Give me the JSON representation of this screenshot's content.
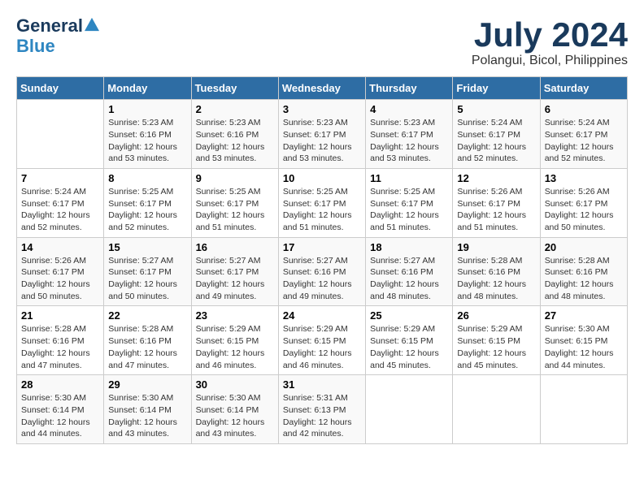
{
  "header": {
    "logo_line1": "General",
    "logo_line2": "Blue",
    "month_title": "July 2024",
    "subtitle": "Polangui, Bicol, Philippines"
  },
  "days_of_week": [
    "Sunday",
    "Monday",
    "Tuesday",
    "Wednesday",
    "Thursday",
    "Friday",
    "Saturday"
  ],
  "weeks": [
    [
      {
        "day": "",
        "info": ""
      },
      {
        "day": "1",
        "info": "Sunrise: 5:23 AM\nSunset: 6:16 PM\nDaylight: 12 hours\nand 53 minutes."
      },
      {
        "day": "2",
        "info": "Sunrise: 5:23 AM\nSunset: 6:16 PM\nDaylight: 12 hours\nand 53 minutes."
      },
      {
        "day": "3",
        "info": "Sunrise: 5:23 AM\nSunset: 6:17 PM\nDaylight: 12 hours\nand 53 minutes."
      },
      {
        "day": "4",
        "info": "Sunrise: 5:23 AM\nSunset: 6:17 PM\nDaylight: 12 hours\nand 53 minutes."
      },
      {
        "day": "5",
        "info": "Sunrise: 5:24 AM\nSunset: 6:17 PM\nDaylight: 12 hours\nand 52 minutes."
      },
      {
        "day": "6",
        "info": "Sunrise: 5:24 AM\nSunset: 6:17 PM\nDaylight: 12 hours\nand 52 minutes."
      }
    ],
    [
      {
        "day": "7",
        "info": "Sunrise: 5:24 AM\nSunset: 6:17 PM\nDaylight: 12 hours\nand 52 minutes."
      },
      {
        "day": "8",
        "info": "Sunrise: 5:25 AM\nSunset: 6:17 PM\nDaylight: 12 hours\nand 52 minutes."
      },
      {
        "day": "9",
        "info": "Sunrise: 5:25 AM\nSunset: 6:17 PM\nDaylight: 12 hours\nand 51 minutes."
      },
      {
        "day": "10",
        "info": "Sunrise: 5:25 AM\nSunset: 6:17 PM\nDaylight: 12 hours\nand 51 minutes."
      },
      {
        "day": "11",
        "info": "Sunrise: 5:25 AM\nSunset: 6:17 PM\nDaylight: 12 hours\nand 51 minutes."
      },
      {
        "day": "12",
        "info": "Sunrise: 5:26 AM\nSunset: 6:17 PM\nDaylight: 12 hours\nand 51 minutes."
      },
      {
        "day": "13",
        "info": "Sunrise: 5:26 AM\nSunset: 6:17 PM\nDaylight: 12 hours\nand 50 minutes."
      }
    ],
    [
      {
        "day": "14",
        "info": "Sunrise: 5:26 AM\nSunset: 6:17 PM\nDaylight: 12 hours\nand 50 minutes."
      },
      {
        "day": "15",
        "info": "Sunrise: 5:27 AM\nSunset: 6:17 PM\nDaylight: 12 hours\nand 50 minutes."
      },
      {
        "day": "16",
        "info": "Sunrise: 5:27 AM\nSunset: 6:17 PM\nDaylight: 12 hours\nand 49 minutes."
      },
      {
        "day": "17",
        "info": "Sunrise: 5:27 AM\nSunset: 6:16 PM\nDaylight: 12 hours\nand 49 minutes."
      },
      {
        "day": "18",
        "info": "Sunrise: 5:27 AM\nSunset: 6:16 PM\nDaylight: 12 hours\nand 48 minutes."
      },
      {
        "day": "19",
        "info": "Sunrise: 5:28 AM\nSunset: 6:16 PM\nDaylight: 12 hours\nand 48 minutes."
      },
      {
        "day": "20",
        "info": "Sunrise: 5:28 AM\nSunset: 6:16 PM\nDaylight: 12 hours\nand 48 minutes."
      }
    ],
    [
      {
        "day": "21",
        "info": "Sunrise: 5:28 AM\nSunset: 6:16 PM\nDaylight: 12 hours\nand 47 minutes."
      },
      {
        "day": "22",
        "info": "Sunrise: 5:28 AM\nSunset: 6:16 PM\nDaylight: 12 hours\nand 47 minutes."
      },
      {
        "day": "23",
        "info": "Sunrise: 5:29 AM\nSunset: 6:15 PM\nDaylight: 12 hours\nand 46 minutes."
      },
      {
        "day": "24",
        "info": "Sunrise: 5:29 AM\nSunset: 6:15 PM\nDaylight: 12 hours\nand 46 minutes."
      },
      {
        "day": "25",
        "info": "Sunrise: 5:29 AM\nSunset: 6:15 PM\nDaylight: 12 hours\nand 45 minutes."
      },
      {
        "day": "26",
        "info": "Sunrise: 5:29 AM\nSunset: 6:15 PM\nDaylight: 12 hours\nand 45 minutes."
      },
      {
        "day": "27",
        "info": "Sunrise: 5:30 AM\nSunset: 6:15 PM\nDaylight: 12 hours\nand 44 minutes."
      }
    ],
    [
      {
        "day": "28",
        "info": "Sunrise: 5:30 AM\nSunset: 6:14 PM\nDaylight: 12 hours\nand 44 minutes."
      },
      {
        "day": "29",
        "info": "Sunrise: 5:30 AM\nSunset: 6:14 PM\nDaylight: 12 hours\nand 43 minutes."
      },
      {
        "day": "30",
        "info": "Sunrise: 5:30 AM\nSunset: 6:14 PM\nDaylight: 12 hours\nand 43 minutes."
      },
      {
        "day": "31",
        "info": "Sunrise: 5:31 AM\nSunset: 6:13 PM\nDaylight: 12 hours\nand 42 minutes."
      },
      {
        "day": "",
        "info": ""
      },
      {
        "day": "",
        "info": ""
      },
      {
        "day": "",
        "info": ""
      }
    ]
  ]
}
